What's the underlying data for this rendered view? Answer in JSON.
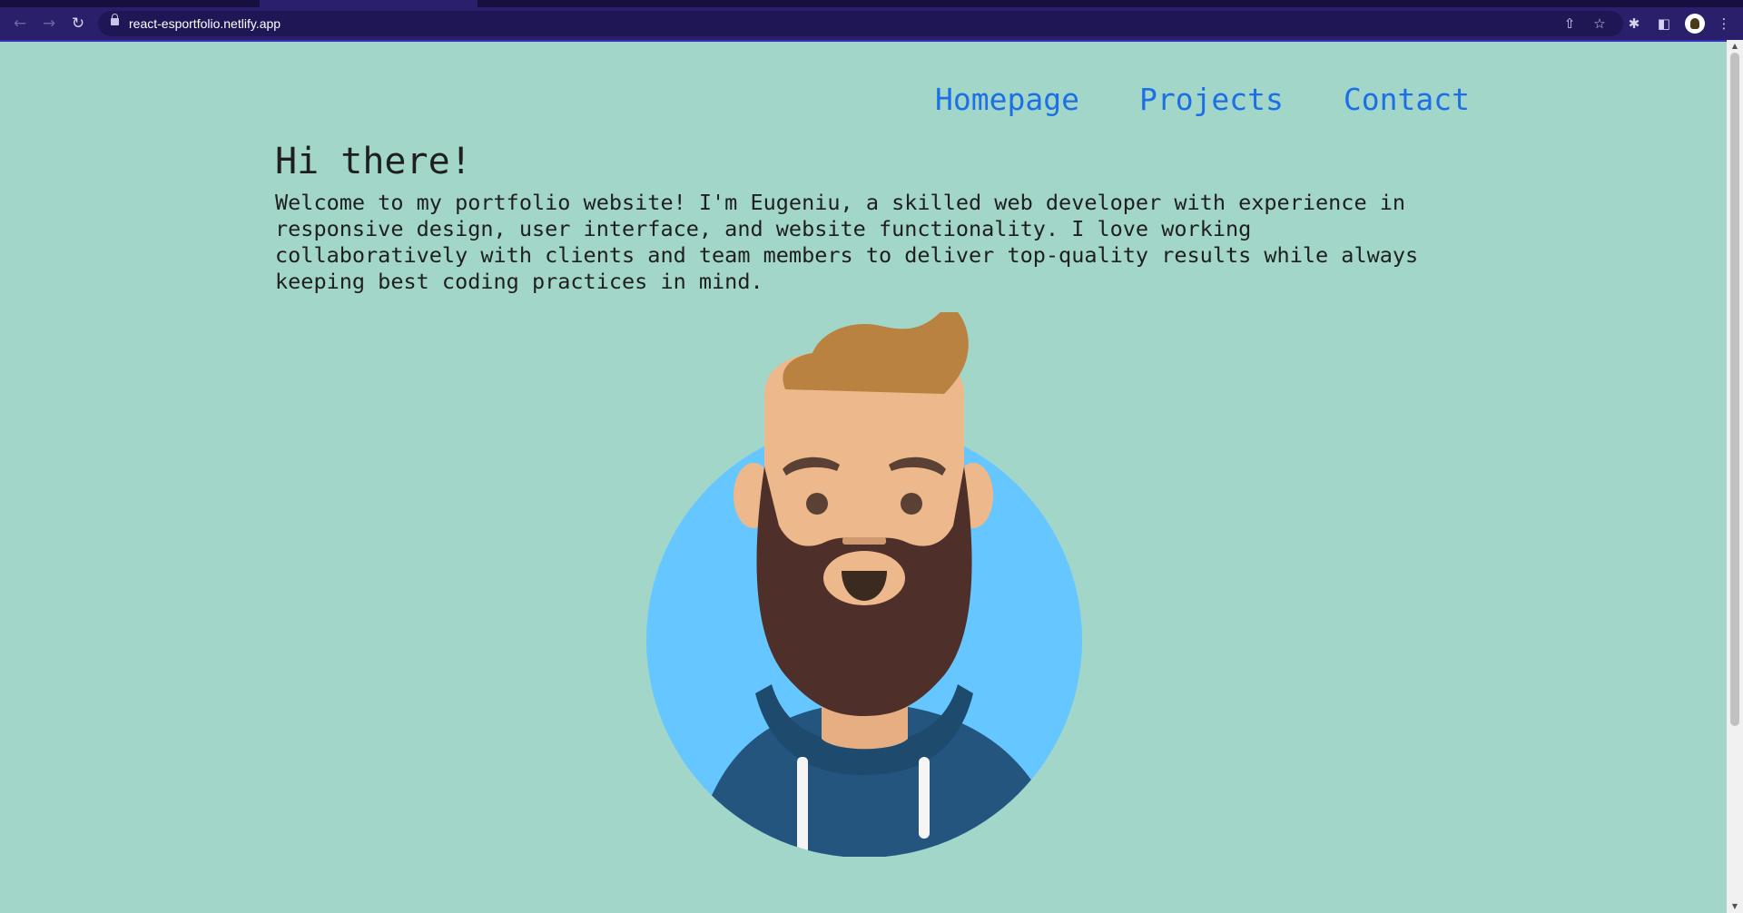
{
  "browser": {
    "url": "react-esportfolio.netlify.app",
    "icons": {
      "back": "←",
      "forward": "→",
      "reload": "↻",
      "share": "⇧",
      "star": "☆",
      "extensions": "✱",
      "side_panel": "◧",
      "menu": "⋮"
    }
  },
  "nav": {
    "items": [
      {
        "label": "Homepage"
      },
      {
        "label": "Projects"
      },
      {
        "label": "Contact"
      }
    ]
  },
  "hero": {
    "title": "Hi there!",
    "text": "Welcome to my portfolio website! I'm Eugeniu, a skilled web developer with experience in responsive design, user interface, and website functionality. I love working collaboratively with clients and team members to deliver top-quality results while always keeping best coding practices in mind."
  },
  "colors": {
    "page_bg": "#a1d6c9",
    "nav_link": "#1d6fe6",
    "avatar_circle": "#66c6ff",
    "hair": "#b98240",
    "skin": "#ecb88c",
    "beard": "#4e2f29",
    "hoodie": "#24557e"
  }
}
